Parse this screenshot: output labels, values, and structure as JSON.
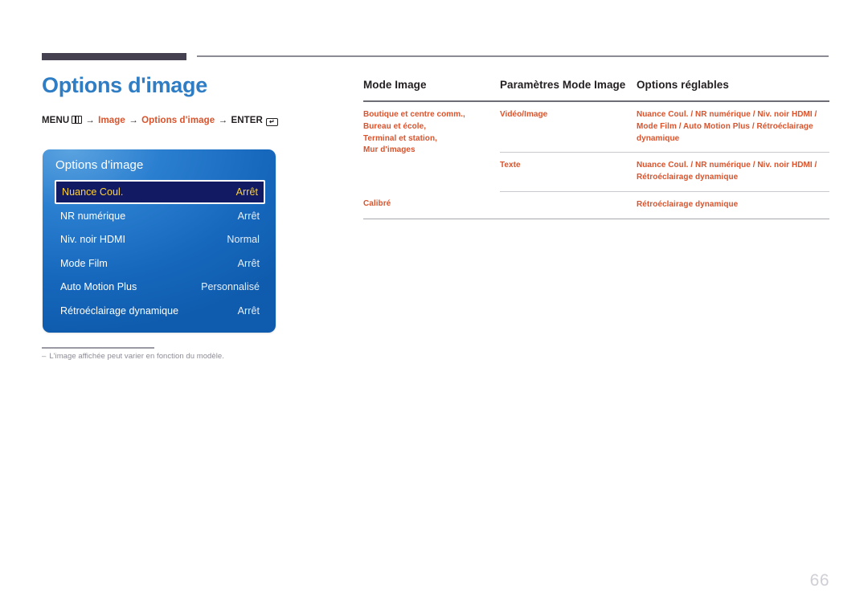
{
  "page": {
    "title": "Options d'image",
    "number": "66",
    "footnote": {
      "dash": "‒",
      "text": "L'image affichée peut varier en fonction du modèle."
    }
  },
  "breadcrumb": {
    "menu_label": "MENU",
    "menu_icon": "menu-icon",
    "arrow": "→",
    "step1": "Image",
    "step2": "Options d'image",
    "enter_label": "ENTER",
    "enter_icon": "enter-icon",
    "enter_glyph": "↵"
  },
  "osd": {
    "title": "Options d'image",
    "rows": [
      {
        "label": "Nuance Coul.",
        "value": "Arrêt",
        "selected": true
      },
      {
        "label": "NR numérique",
        "value": "Arrêt",
        "selected": false
      },
      {
        "label": "Niv. noir HDMI",
        "value": "Normal",
        "selected": false
      },
      {
        "label": "Mode Film",
        "value": "Arrêt",
        "selected": false
      },
      {
        "label": "Auto Motion Plus",
        "value": "Personnalisé",
        "selected": false
      },
      {
        "label": "Rétroéclairage dynamique",
        "value": "Arrêt",
        "selected": false
      }
    ]
  },
  "table": {
    "headers": [
      "Mode Image",
      "Paramètres Mode Image",
      "Options réglables"
    ],
    "rows": [
      {
        "mode_image": "Boutique et centre comm.,\nBureau et école,\nTerminal et station,\nMur d'images",
        "parametres": "Vidéo/Image",
        "options": "Nuance Coul. / NR numérique / Niv. noir HDMI / Mode Film / Auto Motion Plus / Rétroéclairage dynamique"
      },
      {
        "mode_image": "",
        "parametres": "Texte",
        "options": "Nuance Coul. / NR numérique / Niv. noir HDMI / Rétroéclairage dynamique"
      },
      {
        "mode_image": "Calibré",
        "parametres": "",
        "options": "Rétroéclairage dynamique"
      }
    ]
  },
  "colors": {
    "accent_orange": "#d9532c",
    "title_blue": "#2f7dc4",
    "osd_blue": "#1668bd",
    "osd_selected_bg": "#111a63",
    "osd_selected_text": "#ffd23b",
    "rule_dark": "#454150",
    "page_number_gray": "#cfcfd6"
  }
}
